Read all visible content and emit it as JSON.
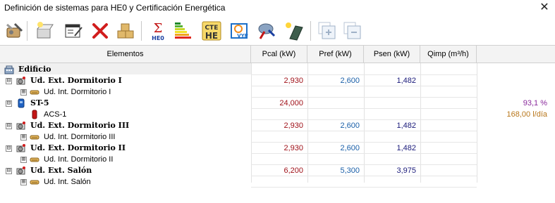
{
  "window": {
    "title": "Definición de sistemas para HE0 y Certificación Energética"
  },
  "toolbar": {
    "buttons": [
      {
        "name": "equipment-tools-icon"
      },
      {
        "name": "light-box-icon"
      },
      {
        "name": "form-edit-icon"
      },
      {
        "name": "delete-icon"
      },
      {
        "name": "boxes-icon"
      },
      {
        "name": "sum-he0-icon",
        "label": "HE0"
      },
      {
        "name": "energy-rating-icon"
      },
      {
        "name": "cte-he-icon",
        "label_top": "CTE",
        "label_bottom": "HE"
      },
      {
        "name": "vyp-icon",
        "label": "VYP"
      },
      {
        "name": "disk-transfer-icon"
      },
      {
        "name": "solar-panel-icon"
      },
      {
        "name": "add-window-icon"
      },
      {
        "name": "remove-window-icon"
      }
    ]
  },
  "table": {
    "headers": {
      "elementos": "Elementos",
      "pcal": "Pcal (kW)",
      "pref": "Pref (kW)",
      "psen": "Psen (kW)",
      "qimp": "Qimp (m³/h)"
    },
    "rows": [
      {
        "label": "Edificio",
        "bold": true,
        "expander": "",
        "icon": "building-icon",
        "pcal": "",
        "pref": "",
        "psen": "",
        "extra": ""
      },
      {
        "label": "Ud. Ext. Dormitorio I",
        "bold": true,
        "expander": "⊟",
        "icon": "outdoor-unit-icon",
        "pcal": "2,930",
        "pref": "2,600",
        "psen": "1,482",
        "extra": ""
      },
      {
        "label": "Ud. Int. Dormitorio I",
        "bold": false,
        "expander": "⊞",
        "icon": "indoor-unit-icon",
        "pcal": "",
        "pref": "",
        "psen": "",
        "extra": ""
      },
      {
        "label": "ST-5",
        "bold": true,
        "expander": "⊟",
        "icon": "water-heater-icon",
        "pcal": "24,000",
        "pref": "",
        "psen": "",
        "extra": "93,1 %"
      },
      {
        "label": "ACS-1",
        "bold": false,
        "expander": "",
        "icon": "dhw-tank-icon",
        "pcal": "",
        "pref": "",
        "psen": "",
        "extra": "168,00 l/día"
      },
      {
        "label": "Ud. Ext. Dormitorio III",
        "bold": true,
        "expander": "⊟",
        "icon": "outdoor-unit-icon",
        "pcal": "2,930",
        "pref": "2,600",
        "psen": "1,482",
        "extra": ""
      },
      {
        "label": "Ud. Int. Dormitorio III",
        "bold": false,
        "expander": "⊞",
        "icon": "indoor-unit-icon",
        "pcal": "",
        "pref": "",
        "psen": "",
        "extra": ""
      },
      {
        "label": "Ud. Ext. Dormitorio II",
        "bold": true,
        "expander": "⊟",
        "icon": "outdoor-unit-icon",
        "pcal": "2,930",
        "pref": "2,600",
        "psen": "1,482",
        "extra": ""
      },
      {
        "label": "Ud. Int. Dormitorio II",
        "bold": false,
        "expander": "⊞",
        "icon": "indoor-unit-icon",
        "pcal": "",
        "pref": "",
        "psen": "",
        "extra": ""
      },
      {
        "label": "Ud. Ext. Salón",
        "bold": true,
        "expander": "⊟",
        "icon": "outdoor-unit-icon",
        "pcal": "6,200",
        "pref": "5,300",
        "psen": "3,975",
        "extra": ""
      },
      {
        "label": "Ud. Int. Salón",
        "bold": false,
        "expander": "⊞",
        "icon": "indoor-unit-icon",
        "pcal": "",
        "pref": "",
        "psen": "",
        "extra": ""
      }
    ]
  },
  "colors": {
    "pcal": "#a0121a",
    "pref": "#1a5fa8",
    "psen": "#1a1a7a",
    "percent": "#8a2a9c",
    "volume": "#b8761a"
  }
}
